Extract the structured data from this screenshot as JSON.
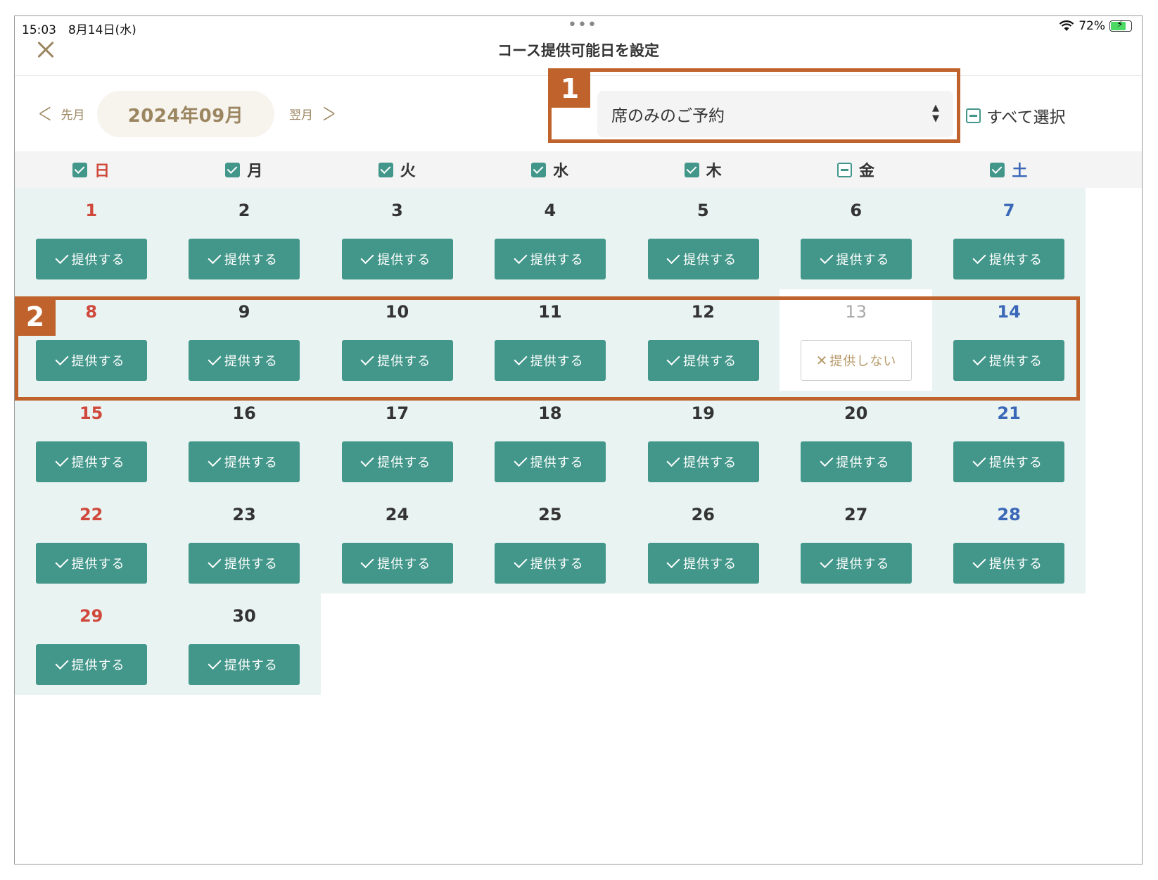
{
  "status_bar": {
    "time_date": "15:03　8月14日(水)",
    "dots": "•••",
    "battery": "72%"
  },
  "header": {
    "title": "コース提供可能日を設定"
  },
  "month_nav": {
    "prev_label": "先月",
    "month": "2024年09月",
    "next_label": "翌月"
  },
  "course_select": {
    "value": "席のみのご予約"
  },
  "select_all": {
    "label": "すべて選択",
    "state": "partial"
  },
  "annotations": [
    "1",
    "2"
  ],
  "colors": {
    "accent": "#43978a",
    "cell_background": "#e9f4f2",
    "sunday": "#d0483b",
    "saturday": "#3b67b8",
    "brand_gold": "#9b8660",
    "annotation": "#c0622c"
  },
  "weekdays": [
    {
      "label": "日",
      "state": "checked"
    },
    {
      "label": "月",
      "state": "checked"
    },
    {
      "label": "火",
      "state": "checked"
    },
    {
      "label": "水",
      "state": "checked"
    },
    {
      "label": "木",
      "state": "checked"
    },
    {
      "label": "金",
      "state": "partial"
    },
    {
      "label": "土",
      "state": "checked"
    }
  ],
  "offer_label": "提供する",
  "not_offer_label": "提供しない",
  "days": [
    {
      "day": "1",
      "offered": true
    },
    {
      "day": "2",
      "offered": true
    },
    {
      "day": "3",
      "offered": true
    },
    {
      "day": "4",
      "offered": true
    },
    {
      "day": "5",
      "offered": true
    },
    {
      "day": "6",
      "offered": true
    },
    {
      "day": "7",
      "offered": true
    },
    {
      "day": "8",
      "offered": true
    },
    {
      "day": "9",
      "offered": true
    },
    {
      "day": "10",
      "offered": true
    },
    {
      "day": "11",
      "offered": true
    },
    {
      "day": "12",
      "offered": true
    },
    {
      "day": "13",
      "offered": false
    },
    {
      "day": "14",
      "offered": true
    },
    {
      "day": "15",
      "offered": true
    },
    {
      "day": "16",
      "offered": true
    },
    {
      "day": "17",
      "offered": true
    },
    {
      "day": "18",
      "offered": true
    },
    {
      "day": "19",
      "offered": true
    },
    {
      "day": "20",
      "offered": true
    },
    {
      "day": "21",
      "offered": true
    },
    {
      "day": "22",
      "offered": true
    },
    {
      "day": "23",
      "offered": true
    },
    {
      "day": "24",
      "offered": true
    },
    {
      "day": "25",
      "offered": true
    },
    {
      "day": "26",
      "offered": true
    },
    {
      "day": "27",
      "offered": true
    },
    {
      "day": "28",
      "offered": true
    },
    {
      "day": "29",
      "offered": true
    },
    {
      "day": "30",
      "offered": true
    }
  ]
}
